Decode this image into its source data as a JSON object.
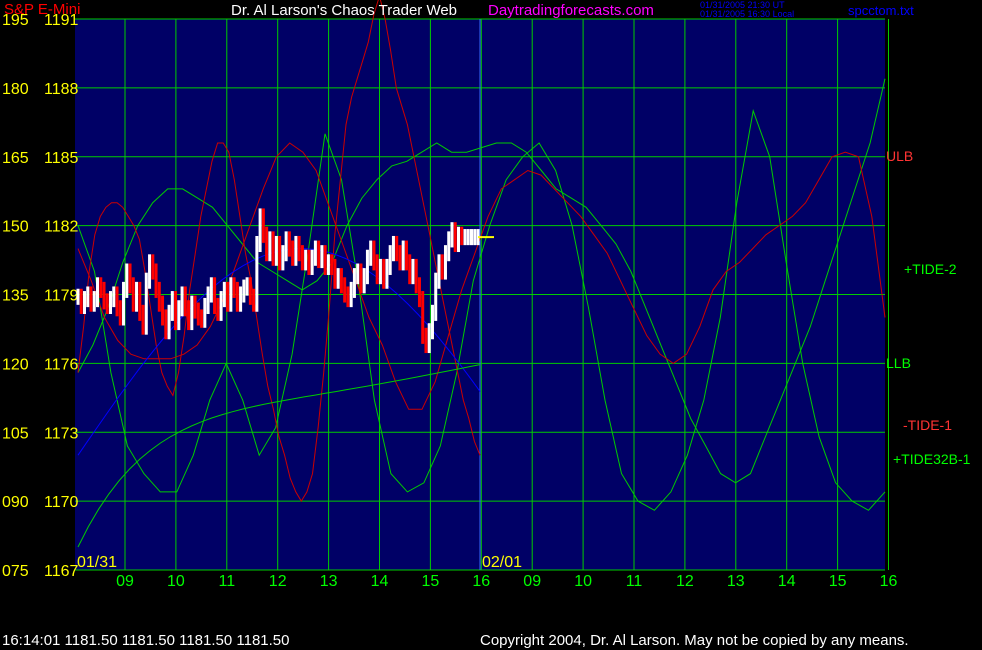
{
  "header": {
    "instrument": "S&P E-Mini",
    "title": "Dr. Al Larson's Chaos Trader Web",
    "site": "Daytradingforecasts.com",
    "time_ut": "01/31/2005 21:30 UT",
    "time_local": "01/31/2005 16:30 Local",
    "file": "spcctom.txt"
  },
  "footer": {
    "quote": "16:14:01  1181.50 1181.50 1181.50 1181.50",
    "copyright": "Copyright 2004, Dr. Al Larson. May not be copied by any means."
  },
  "colors": {
    "background": "#000066",
    "panel": "#000000",
    "grid": "#00cc00",
    "axis_text": "#ffff00",
    "time_text": "#00ff00",
    "price_up": "#ffffff",
    "price_down": "#ff0000",
    "red_line": "#cc0000",
    "green_line": "#00cc00",
    "blue_line": "#0000ff",
    "title": "#ffffff",
    "site": "#ff00ff",
    "instrument": "#ff0000",
    "small_text": "#0000ff"
  },
  "chart_data": {
    "type": "line",
    "y_left_ticks": [
      "195",
      "180",
      "165",
      "150",
      "135",
      "120",
      "105",
      "090",
      "075"
    ],
    "y_right_ticks": [
      "1191",
      "1188",
      "1185",
      "1182",
      "1179",
      "1176",
      "1173",
      "1170",
      "1167"
    ],
    "price_range": [
      1167,
      1191
    ],
    "osc_range": [
      75,
      195
    ],
    "date_labels": [
      "01/31",
      "02/01"
    ],
    "x_tick_labels": [
      "09",
      "10",
      "11",
      "12",
      "13",
      "14",
      "15",
      "16",
      "09",
      "10",
      "11",
      "12",
      "13",
      "14",
      "15",
      "16"
    ],
    "series_labels": [
      {
        "name": "ULB",
        "color": "#ff3333"
      },
      {
        "name": "+TIDE-2",
        "color": "#00ff00"
      },
      {
        "name": "LLB",
        "color": "#00ff00"
      },
      {
        "name": "-TIDE-1",
        "color": "#ff3333"
      },
      {
        "name": "+TIDE32B-1",
        "color": "#00ff00"
      }
    ],
    "price": [
      1178.9,
      1178.5,
      1178.8,
      1179.0,
      1178.6,
      1178.8,
      1179.4,
      1179.2,
      1178.7,
      1178.5,
      1178.8,
      1179.0,
      1178.4,
      1178.0,
      1179.2,
      1180.0,
      1179.4,
      1178.6,
      1179.2,
      1178.2,
      1177.6,
      1179.6,
      1180.4,
      1180.0,
      1179.2,
      1178.6,
      1178.0,
      1177.4,
      1178.2,
      1178.8,
      1177.8,
      1178.4,
      1179.0,
      1178.4,
      1177.8,
      1178.6,
      1178.3,
      1178.0,
      1177.9,
      1178.5,
      1179.0,
      1179.4,
      1178.5,
      1178.2,
      1178.8,
      1179.2,
      1178.6,
      1179.4,
      1179.2,
      1178.6,
      1179.0,
      1179.3,
      1179.4,
      1178.9,
      1178.6,
      1181.2,
      1182.4,
      1181.6,
      1180.8,
      1181.4,
      1180.6,
      1181.2,
      1180.4,
      1180.8,
      1181.4,
      1181.0,
      1180.6,
      1181.2,
      1180.8,
      1180.4,
      1180.6,
      1180.2,
      1180.6,
      1181.0,
      1180.5,
      1180.8,
      1180.2,
      1180.4,
      1180.2,
      1179.6,
      1179.8,
      1179.4,
      1179.0,
      1178.8,
      1179.2,
      1179.8,
      1180.0,
      1179.4,
      1179.8,
      1180.6,
      1181.0,
      1180.4,
      1179.8,
      1180.2,
      1179.6,
      1180.2,
      1180.8,
      1181.2,
      1180.8,
      1180.4,
      1181.0,
      1180.4,
      1179.8,
      1180.2,
      1179.4,
      1178.8,
      1177.2,
      1176.8,
      1177.4,
      1178.2,
      1179.6,
      1180.4,
      1180.0,
      1180.8,
      1181.4,
      1181.8,
      1181.2,
      1181.6,
      1181.5,
      1181.5,
      1181.5,
      1181.5,
      1181.5,
      1181.5
    ],
    "osc_a": [
      150,
      140,
      118,
      102,
      96,
      92,
      92,
      100,
      112,
      120,
      112,
      100,
      106,
      122,
      145,
      170,
      160,
      138,
      112,
      96,
      92,
      94,
      102,
      118,
      138,
      150,
      160,
      165,
      168,
      162,
      150,
      132,
      112,
      96,
      90,
      88,
      92,
      100,
      112,
      130,
      155,
      175,
      165,
      142,
      120,
      104,
      94,
      90,
      88,
      92
    ],
    "osc_b": [
      118,
      124,
      132,
      142,
      150,
      155,
      158,
      158,
      156,
      154,
      150,
      146,
      142,
      140,
      138,
      136,
      138,
      142,
      150,
      156,
      160,
      163,
      164,
      166,
      168,
      166,
      166,
      167,
      168,
      168,
      166,
      162,
      158,
      156,
      154,
      150,
      146,
      140,
      132,
      124,
      116,
      108,
      102,
      96,
      94,
      96,
      104,
      112,
      120,
      128,
      138,
      148,
      158,
      168,
      182
    ],
    "osc_c": [
      145,
      138,
      130,
      125,
      122,
      121,
      121,
      121,
      122,
      124,
      128,
      134,
      142,
      150,
      158,
      165,
      168,
      166,
      162,
      154,
      146,
      138,
      130,
      124,
      116,
      110,
      110,
      116,
      126,
      136,
      144,
      152,
      158,
      160,
      162,
      161,
      158,
      155,
      152,
      148,
      144,
      138,
      132,
      126,
      122,
      120,
      122,
      128,
      136,
      140,
      142,
      145,
      148,
      150,
      152,
      155,
      160,
      165,
      166,
      165,
      152,
      130
    ],
    "osc_d": [
      118,
      128,
      140,
      148,
      152,
      154,
      155,
      155,
      154,
      152,
      150,
      147,
      140,
      132,
      124,
      118,
      115,
      113,
      118,
      126,
      136,
      144,
      152,
      158,
      164,
      168,
      168,
      166,
      160,
      152,
      144,
      138,
      130,
      122,
      115,
      110,
      104,
      100,
      95,
      92,
      90,
      92,
      96,
      106,
      118,
      132,
      148,
      160,
      172,
      178,
      182,
      186,
      190,
      196,
      200,
      195,
      188,
      180,
      176,
      172,
      166,
      160,
      154,
      148,
      142,
      136,
      130,
      124,
      118,
      112,
      108,
      103,
      100
    ]
  }
}
